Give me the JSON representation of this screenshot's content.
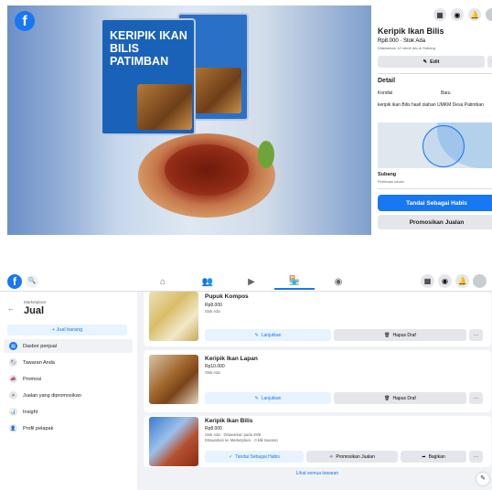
{
  "listing": {
    "title": "Keripik Ikan Bilis",
    "price_stock": "Rp8.000 · Stok Ada",
    "listed_ago": "Ditawarkan 12 menit lalu di Subang",
    "edit_label": "Edit",
    "more_label": "···",
    "detail_heading": "Detail",
    "condition_label": "Kondisi",
    "condition_value": "Baru",
    "description": "keripik ikan Bilis hasil olahan UMKM Desa Patimban",
    "location_city": "Subang",
    "location_note": "Perkiraan lokasi",
    "mark_sold_label": "Tandai Sebagai Habis",
    "promote_label": "Promosikan Jualan",
    "photo_bag_text": "KERIPIK IKAN BILIS PATIMBAN"
  },
  "topbar_icons": [
    "grid-icon",
    "messenger-icon",
    "bell-icon",
    "profile-icon"
  ],
  "nav": {
    "search_icon": "🔍",
    "tabs": [
      {
        "name": "home",
        "glyph": "⌂"
      },
      {
        "name": "friends",
        "glyph": "👥"
      },
      {
        "name": "watch",
        "glyph": "▶"
      },
      {
        "name": "marketplace",
        "glyph": "🏪",
        "active": true
      },
      {
        "name": "groups",
        "glyph": "◉"
      }
    ]
  },
  "sidebar": {
    "subtitle": "Marketplace",
    "title": "Jual",
    "back_glyph": "←",
    "add_item_label": "+ Jual barang",
    "items": [
      {
        "label": "Dasbor penjual",
        "glyph": "▤",
        "active": true
      },
      {
        "label": "Tawaran Anda",
        "glyph": "🏷"
      },
      {
        "label": "Promosi",
        "glyph": "📣"
      },
      {
        "label": "Jualan yang dipromosikan",
        "glyph": "✧"
      },
      {
        "label": "Insight",
        "glyph": "📊"
      },
      {
        "label": "Profil pelapak",
        "glyph": "👤"
      }
    ]
  },
  "listings": [
    {
      "name": "Pupuk Kompos",
      "price": "Rp8.000",
      "status": "Stok Ada",
      "buttons": [
        {
          "label": "Lanjutkan",
          "icon": "✎",
          "style": "blue"
        },
        {
          "label": "Hapus Draf",
          "icon": "🗑",
          "style": "gray"
        }
      ],
      "more": "···"
    },
    {
      "name": "Keripik Ikan Lapan",
      "price": "Rp10.000",
      "status": "Stok Ada",
      "buttons": [
        {
          "label": "Lanjutkan",
          "icon": "✎",
          "style": "blue"
        },
        {
          "label": "Hapus Draf",
          "icon": "🗑",
          "style": "gray"
        }
      ],
      "more": "···"
    },
    {
      "name": "Keripik Ikan Bilis",
      "price": "Rp8.000",
      "status": "Stok Ada · Ditawarkan pada 29/8",
      "status2": "Ditawarkan ke Marketplace · 0 klik tawaran",
      "buttons": [
        {
          "label": "Tandai Sebagai Habis",
          "icon": "✓",
          "style": "blue"
        },
        {
          "label": "Promosikan Jualan",
          "icon": "✧",
          "style": "gray"
        },
        {
          "label": "Bagikan",
          "icon": "➦",
          "style": "gray"
        }
      ],
      "more": "···"
    }
  ],
  "see_all_label": "Lihat semua tawaran",
  "compose_glyph": "✎"
}
